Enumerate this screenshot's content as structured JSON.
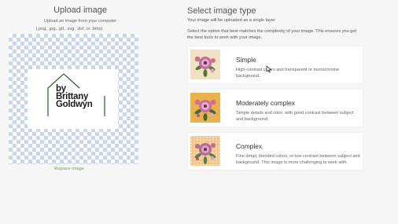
{
  "upload": {
    "title": "Upload image",
    "subtitle": "Upload an image from your computer",
    "formats": "(.png, .jpg, .gif, .svg, .dxf, or .bmp)",
    "logo_line1": "by",
    "logo_line2": "Brittany",
    "logo_line3": "Goldwyn",
    "replace_label": "Replace Image"
  },
  "select": {
    "title": "Select image type",
    "layer_note": "Your image will be uploaded as a single layer",
    "description": "Select the option that best matches the complexity of your image. This ensures you get the best tools to work with your image.",
    "options": [
      {
        "title": "Simple",
        "description": "High-contrast colors and transparent or monochrome background.",
        "thumb_bg": "#f1e2c6"
      },
      {
        "title": "Moderately complex",
        "description": "Simple details and color, with good contrast between subject and background.",
        "thumb_bg": "#ebb24b"
      },
      {
        "title": "Complex",
        "description": "Fine detail, blended colors, or low contrast between subject and background. This image is more challenging to work with.",
        "thumb_bg": "#f1c98f"
      }
    ]
  },
  "colors": {
    "link_green": "#6aa84f",
    "logo_green": "#2e5e2e",
    "checker_blue": "#c9d6ee"
  }
}
